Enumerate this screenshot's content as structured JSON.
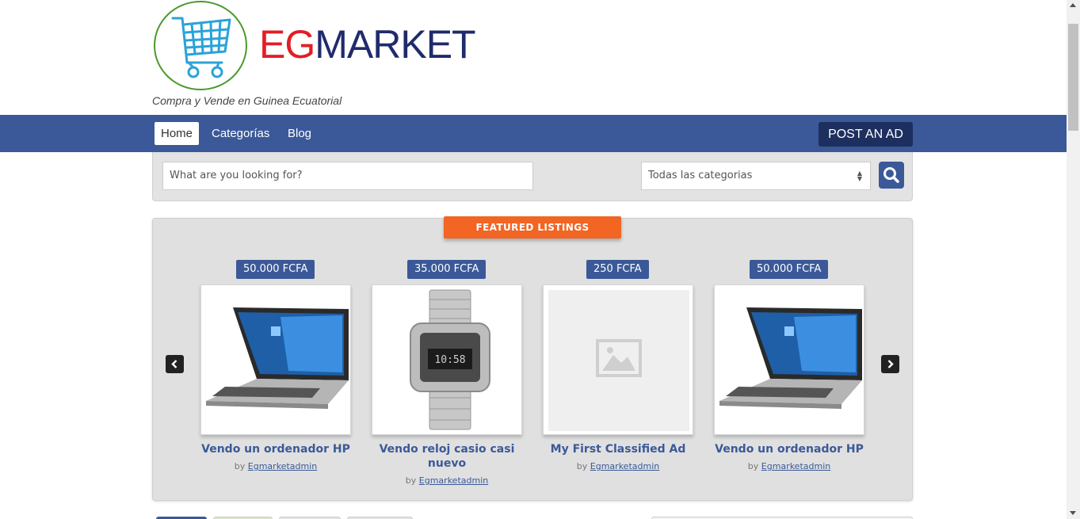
{
  "brand": {
    "logo_eg": "EG",
    "logo_market": "MARKET",
    "tagline": "Compra y Vende en Guinea Ecuatorial",
    "color_red": "#e21e26",
    "color_navy": "#1f2b6b"
  },
  "nav": {
    "items": [
      {
        "label": "Home",
        "active": true
      },
      {
        "label": "Categorías",
        "active": false
      },
      {
        "label": "Blog",
        "active": false
      }
    ],
    "post_ad": "POST AN AD",
    "bg_color": "#3b5998"
  },
  "search": {
    "placeholder": "What are you looking for?",
    "category_selected": "Todas las categorias",
    "button_icon": "search-icon"
  },
  "featured": {
    "heading": "FEATURED LISTINGS",
    "listings": [
      {
        "price": "50.000 FCFA",
        "title": "Vendo un ordenador HP",
        "by": "by",
        "author": "Egmarketadmin",
        "image": "laptop"
      },
      {
        "price": "35.000 FCFA",
        "title": "Vendo reloj casio casi nuevo",
        "by": "by",
        "author": "Egmarketadmin",
        "image": "watch"
      },
      {
        "price": "250 FCFA",
        "title": "My First Classified Ad",
        "by": "by",
        "author": "Egmarketadmin",
        "image": "placeholder"
      },
      {
        "price": "50.000 FCFA",
        "title": "Vendo un ordenador HP",
        "by": "by",
        "author": "Egmarketadmin",
        "image": "laptop"
      }
    ],
    "prev_icon": "chevron-left-icon",
    "next_icon": "chevron-right-icon",
    "accent_color": "#f26522"
  }
}
